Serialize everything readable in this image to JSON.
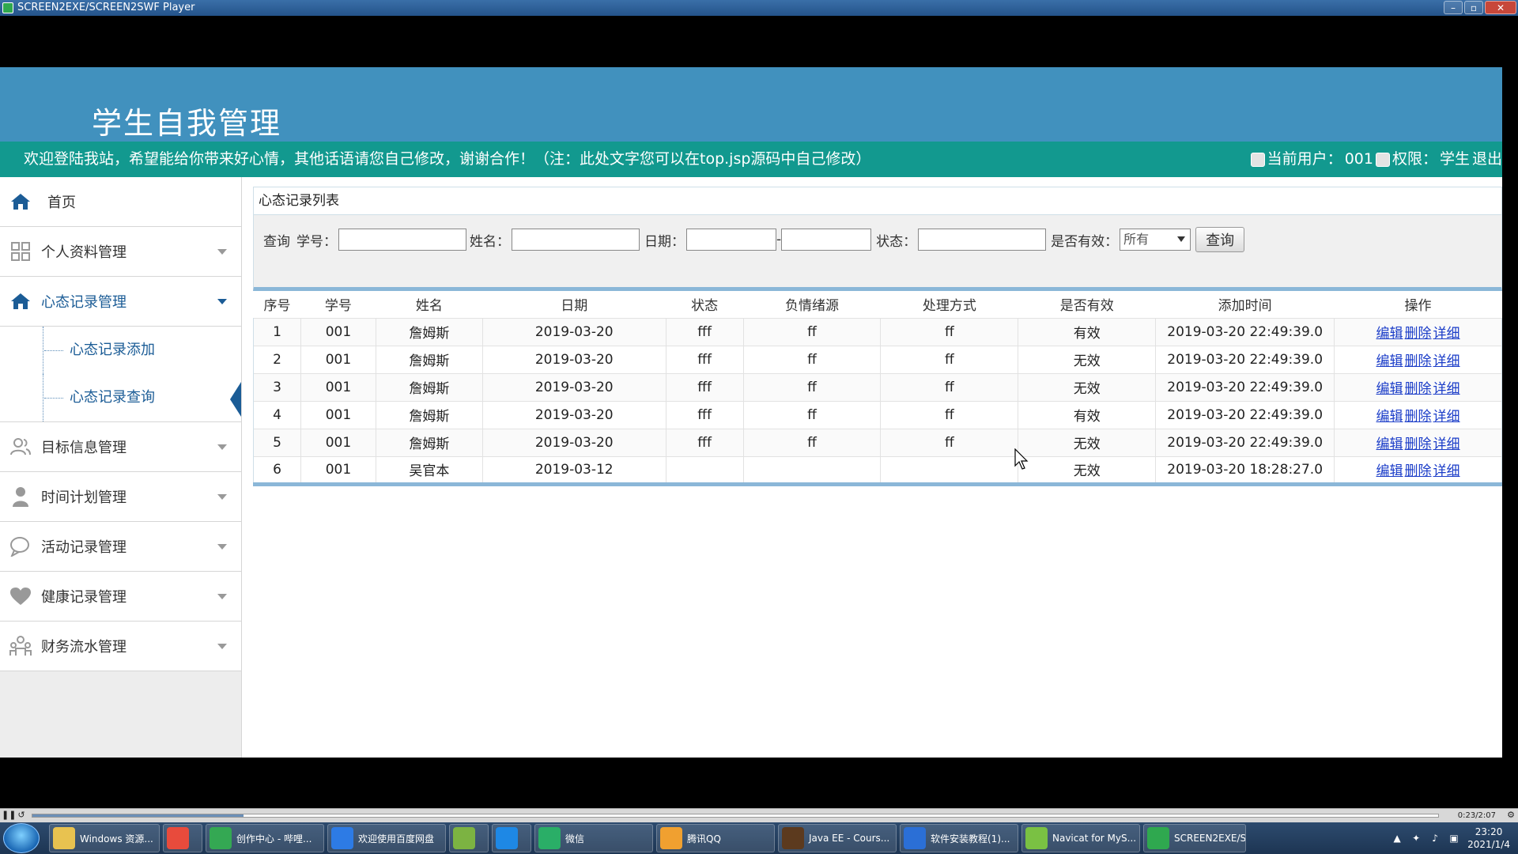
{
  "window": {
    "title": "SCREEN2EXE/SCREEN2SWF Player"
  },
  "site": {
    "title": "学生自我管理",
    "welcome": "欢迎登陆我站，希望能给你带来好心情，其他话语请您自己修改，谢谢合作！（注：此处文字您可以在top.jsp源码中自己修改）",
    "current_user_label": "当前用户：",
    "current_user": "001",
    "permission_label": "权限：",
    "permission": "学生",
    "logout": "退出"
  },
  "sidebar": {
    "home": "首页",
    "items": [
      {
        "label": "个人资料管理",
        "icon": "grid-icon"
      },
      {
        "label": "心态记录管理",
        "icon": "home-icon"
      },
      {
        "label": "目标信息管理",
        "icon": "users-icon"
      },
      {
        "label": "时间计划管理",
        "icon": "user-icon"
      },
      {
        "label": "活动记录管理",
        "icon": "chat-icon"
      },
      {
        "label": "健康记录管理",
        "icon": "heart-icon"
      },
      {
        "label": "财务流水管理",
        "icon": "team-icon"
      }
    ],
    "subitems": [
      "心态记录添加",
      "心态记录查询"
    ]
  },
  "panel": {
    "title": "心态记录列表"
  },
  "search": {
    "prefix": "查询",
    "student_id_label": "学号：",
    "name_label": "姓名：",
    "date_label": "日期：",
    "date_sep": "-",
    "status_label": "状态：",
    "valid_label": "是否有效：",
    "valid_selected": "所有",
    "button": "查询"
  },
  "table": {
    "headers": [
      "序号",
      "学号",
      "姓名",
      "日期",
      "状态",
      "负情绪源",
      "处理方式",
      "是否有效",
      "添加时间",
      "操作"
    ],
    "rows": [
      {
        "no": "1",
        "sid": "001",
        "name": "詹姆斯",
        "date": "2019-03-20",
        "status": "fff",
        "source": "ff",
        "method": "ff",
        "valid": "有效",
        "added": "2019-03-20 22:49:39.0"
      },
      {
        "no": "2",
        "sid": "001",
        "name": "詹姆斯",
        "date": "2019-03-20",
        "status": "fff",
        "source": "ff",
        "method": "ff",
        "valid": "无效",
        "added": "2019-03-20 22:49:39.0"
      },
      {
        "no": "3",
        "sid": "001",
        "name": "詹姆斯",
        "date": "2019-03-20",
        "status": "fff",
        "source": "ff",
        "method": "ff",
        "valid": "无效",
        "added": "2019-03-20 22:49:39.0"
      },
      {
        "no": "4",
        "sid": "001",
        "name": "詹姆斯",
        "date": "2019-03-20",
        "status": "fff",
        "source": "ff",
        "method": "ff",
        "valid": "有效",
        "added": "2019-03-20 22:49:39.0"
      },
      {
        "no": "5",
        "sid": "001",
        "name": "詹姆斯",
        "date": "2019-03-20",
        "status": "fff",
        "source": "ff",
        "method": "ff",
        "valid": "无效",
        "added": "2019-03-20 22:49:39.0"
      },
      {
        "no": "6",
        "sid": "001",
        "name": "吴官本",
        "date": "2019-03-12",
        "status": "",
        "source": "",
        "method": "",
        "valid": "无效",
        "added": "2019-03-20 18:28:27.0"
      }
    ],
    "actions": [
      "编辑",
      "删除",
      "详细"
    ]
  },
  "player": {
    "time": "0:23/2:07",
    "progress": 0.15
  },
  "taskbar": {
    "items": [
      {
        "label": "Windows 资源...",
        "color": "#e8c250"
      },
      {
        "label": "",
        "color": "#e84b3c"
      },
      {
        "label": "创作中心 - 哔哩...",
        "color": "#34a853"
      },
      {
        "label": "欢迎使用百度网盘",
        "color": "#2d7be5"
      },
      {
        "label": "",
        "color": "#7cb342"
      },
      {
        "label": "",
        "color": "#1e88e5"
      },
      {
        "label": "微信",
        "color": "#2aae67"
      },
      {
        "label": "腾讯QQ",
        "color": "#f0a030"
      },
      {
        "label": "Java EE - Cours...",
        "color": "#5c3a1e"
      },
      {
        "label": "软件安装教程(1)...",
        "color": "#2b6fd6"
      },
      {
        "label": "Navicat for MyS...",
        "color": "#7ac143"
      },
      {
        "label": "SCREEN2EXE/S...",
        "color": "#2fa84f"
      }
    ],
    "time": "23:20",
    "date": "2021/1/4"
  }
}
